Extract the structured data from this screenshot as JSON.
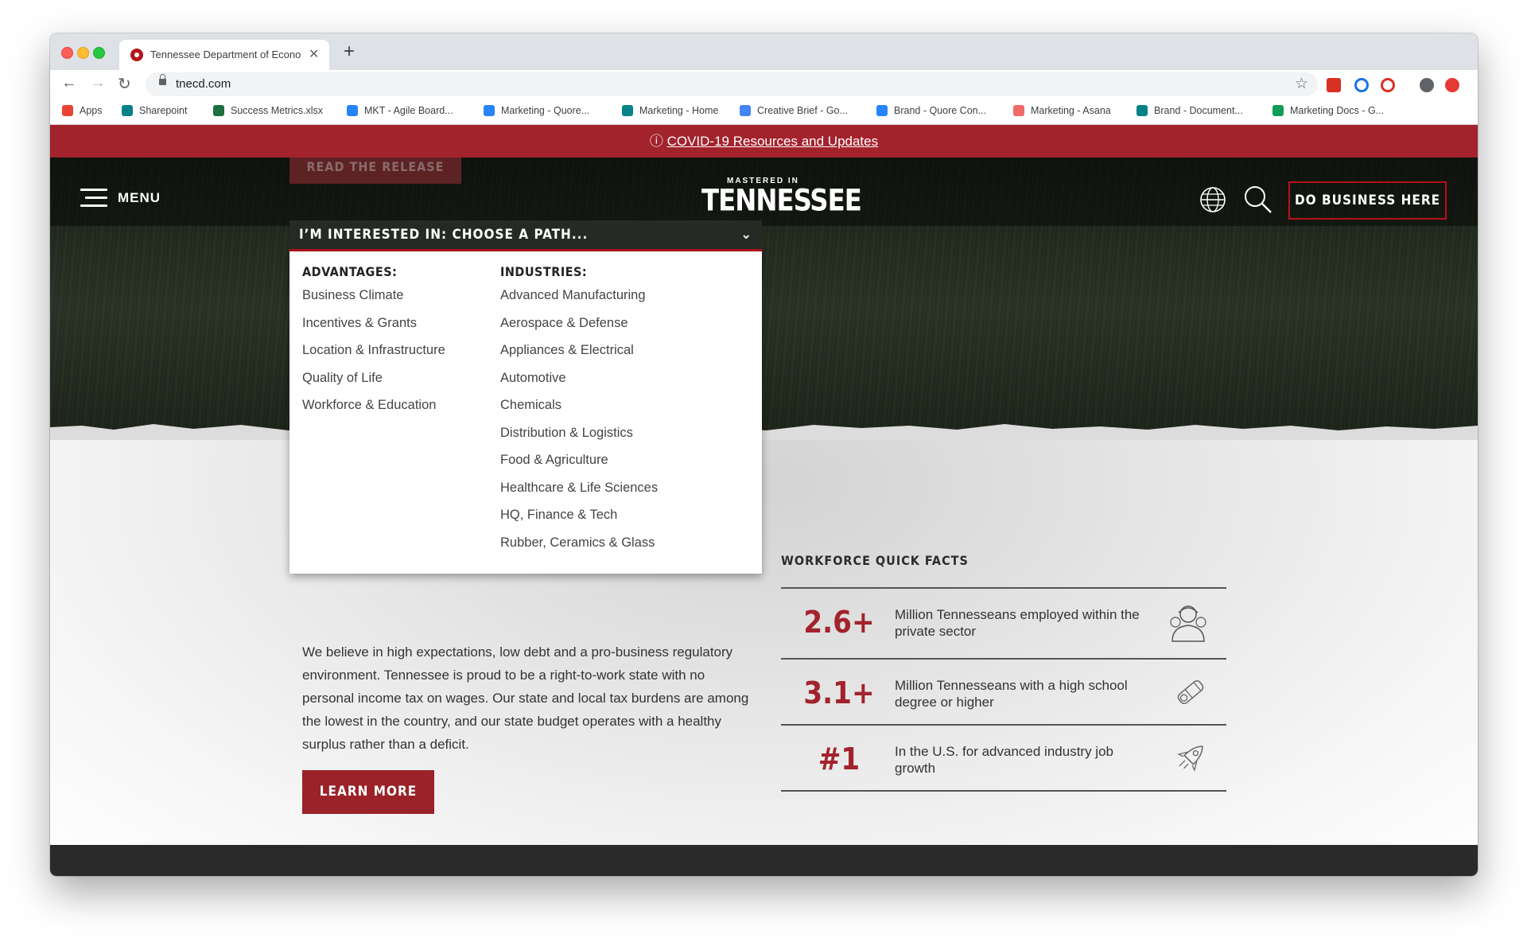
{
  "browser": {
    "tab_title": "Tennessee Department of Econo",
    "tab_close": "✕",
    "new_tab": "+",
    "url": "tnecd.com",
    "back": "←",
    "forward": "→",
    "reload": "↻",
    "star": "☆"
  },
  "bookmarks": [
    {
      "label": "Apps",
      "color": "#ea4335"
    },
    {
      "label": "Sharepoint",
      "color": "#038387"
    },
    {
      "label": "Success Metrics.xlsx",
      "color": "#1d6f42"
    },
    {
      "label": "MKT - Agile Board...",
      "color": "#2684ff"
    },
    {
      "label": "Marketing - Quore...",
      "color": "#2684ff"
    },
    {
      "label": "Marketing - Home",
      "color": "#038387"
    },
    {
      "label": "Creative Brief - Go...",
      "color": "#4285f4"
    },
    {
      "label": "Brand - Quore Con...",
      "color": "#2684ff"
    },
    {
      "label": "Marketing - Asana",
      "color": "#f06a6a"
    },
    {
      "label": "Brand - Document...",
      "color": "#038387"
    },
    {
      "label": "Marketing Docs - G...",
      "color": "#0f9d58"
    }
  ],
  "site": {
    "covid_banner": "COVID-19 Resources and Updates",
    "read_release": "READ THE RELEASE",
    "menu_label": "MENU",
    "logo_top": "MASTERED IN",
    "logo_main": "TENNESSEE",
    "do_business": "DO BUSINESS HERE",
    "path_label": "I’M INTERESTED IN: CHOOSE A PATH...",
    "path_chevron": "⌄",
    "accent_color": "#a2232c"
  },
  "dropdown": {
    "advantages_head": "ADVANTAGES:",
    "advantages": [
      "Business Climate",
      "Incentives & Grants",
      "Location & Infrastructure",
      "Quality of Life",
      "Workforce & Education"
    ],
    "industries_head": "INDUSTRIES:",
    "industries": [
      "Advanced Manufacturing",
      "Aerospace & Defense",
      "Appliances & Electrical",
      "Automotive",
      "Chemicals",
      "Distribution & Logistics",
      "Food & Agriculture",
      "Healthcare & Life Sciences",
      "HQ, Finance & Tech",
      "Rubber, Ceramics & Glass"
    ]
  },
  "content": {
    "body": "We believe in high expectations, low debt and a pro-business regulatory environment. Tennessee is proud to be a right-to-work state with no personal income tax on wages. Our state and local tax burdens are among the lowest in the country, and our state budget operates with a healthy surplus rather than a deficit.",
    "learn_more": "LEARN MORE"
  },
  "quick_facts": {
    "title": "WORKFORCE QUICK FACTS",
    "rows": [
      {
        "number": "2.6+",
        "text": "Million Tennesseans employed within the private sector",
        "icon": "workers-icon"
      },
      {
        "number": "3.1+",
        "text": "Million Tennesseans with a high school degree or higher",
        "icon": "diploma-icon"
      },
      {
        "number": "#1",
        "text": "In the U.S. for advanced industry job growth",
        "icon": "rocket-icon"
      }
    ]
  }
}
